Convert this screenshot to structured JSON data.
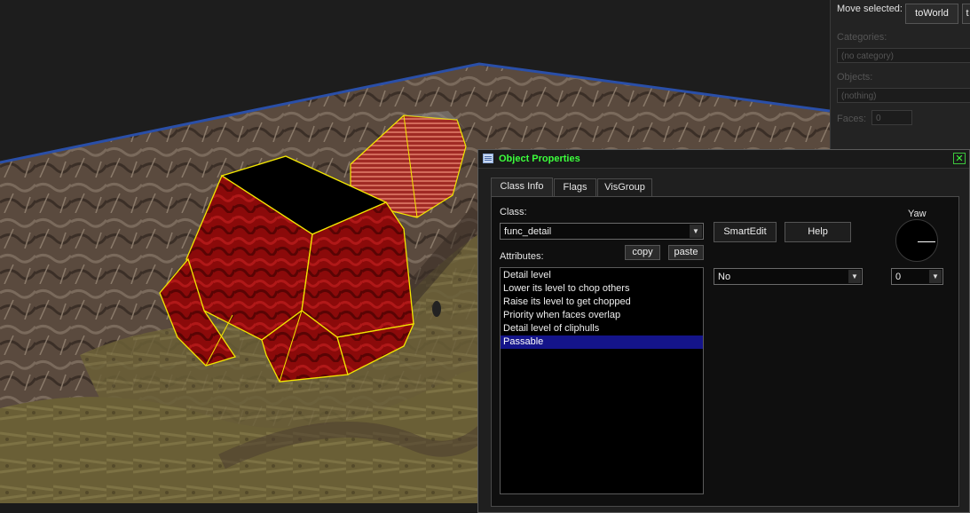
{
  "side_panel": {
    "move_selected_label": "Move selected:",
    "to_world_button": "toWorld",
    "next_button": "t",
    "categories_label": "Categories:",
    "categories_value": "(no category)",
    "objects_label": "Objects:",
    "objects_value": "(nothing)",
    "faces_label": "Faces:",
    "faces_value": "0"
  },
  "dialog": {
    "title": "Object Properties",
    "close_glyph": "✕",
    "tabs": [
      {
        "label": "Class Info",
        "active": true
      },
      {
        "label": "Flags",
        "active": false
      },
      {
        "label": "VisGroup",
        "active": false
      }
    ],
    "class_label": "Class:",
    "class_value": "func_detail",
    "smartedit_button": "SmartEdit",
    "help_button": "Help",
    "yaw_label": "Yaw",
    "attributes_label": "Attributes:",
    "copy_button": "copy",
    "paste_button": "paste",
    "attributes": [
      {
        "label": "Detail level",
        "selected": false
      },
      {
        "label": "Lower its level to chop others",
        "selected": false
      },
      {
        "label": "Raise its level to get chopped",
        "selected": false
      },
      {
        "label": "Priority when faces overlap",
        "selected": false
      },
      {
        "label": "Detail level of cliphulls",
        "selected": false
      },
      {
        "label": "Passable",
        "selected": true
      }
    ],
    "value_combo": "No",
    "value_combo2": "0"
  },
  "colors": {
    "title_green": "#3cff3c",
    "selection_blue": "#14148a",
    "brush_red": "#8b0a0a",
    "selection_yellow": "#f2e600"
  },
  "icons": [
    "dialog-app-icon",
    "close-icon",
    "dropdown-arrow-icon"
  ]
}
